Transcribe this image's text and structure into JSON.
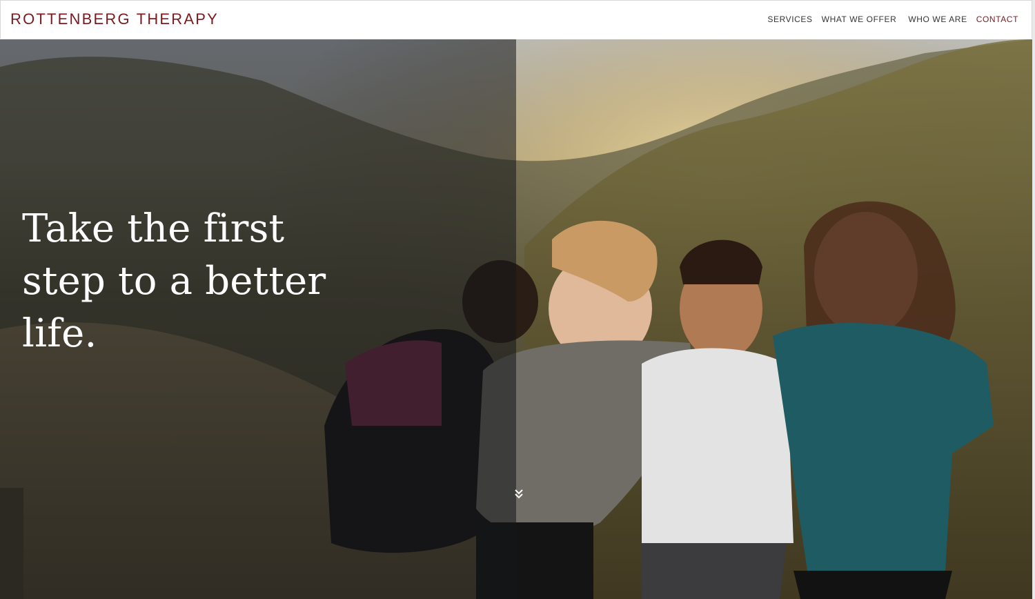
{
  "header": {
    "logo": "ROTTENBERG THERAPY",
    "nav": {
      "services": "SERVICES",
      "what_we_offer": "WHAT WE OFFER",
      "who_we_are": "WHO WE ARE",
      "contact": "CONTACT"
    }
  },
  "hero": {
    "title": "Take the first step to a better life.",
    "scroll_icon": "double-chevron-down-icon"
  },
  "colors": {
    "brand": "#7a1a1f",
    "nav_text": "#333333",
    "hero_text": "#ffffff"
  }
}
